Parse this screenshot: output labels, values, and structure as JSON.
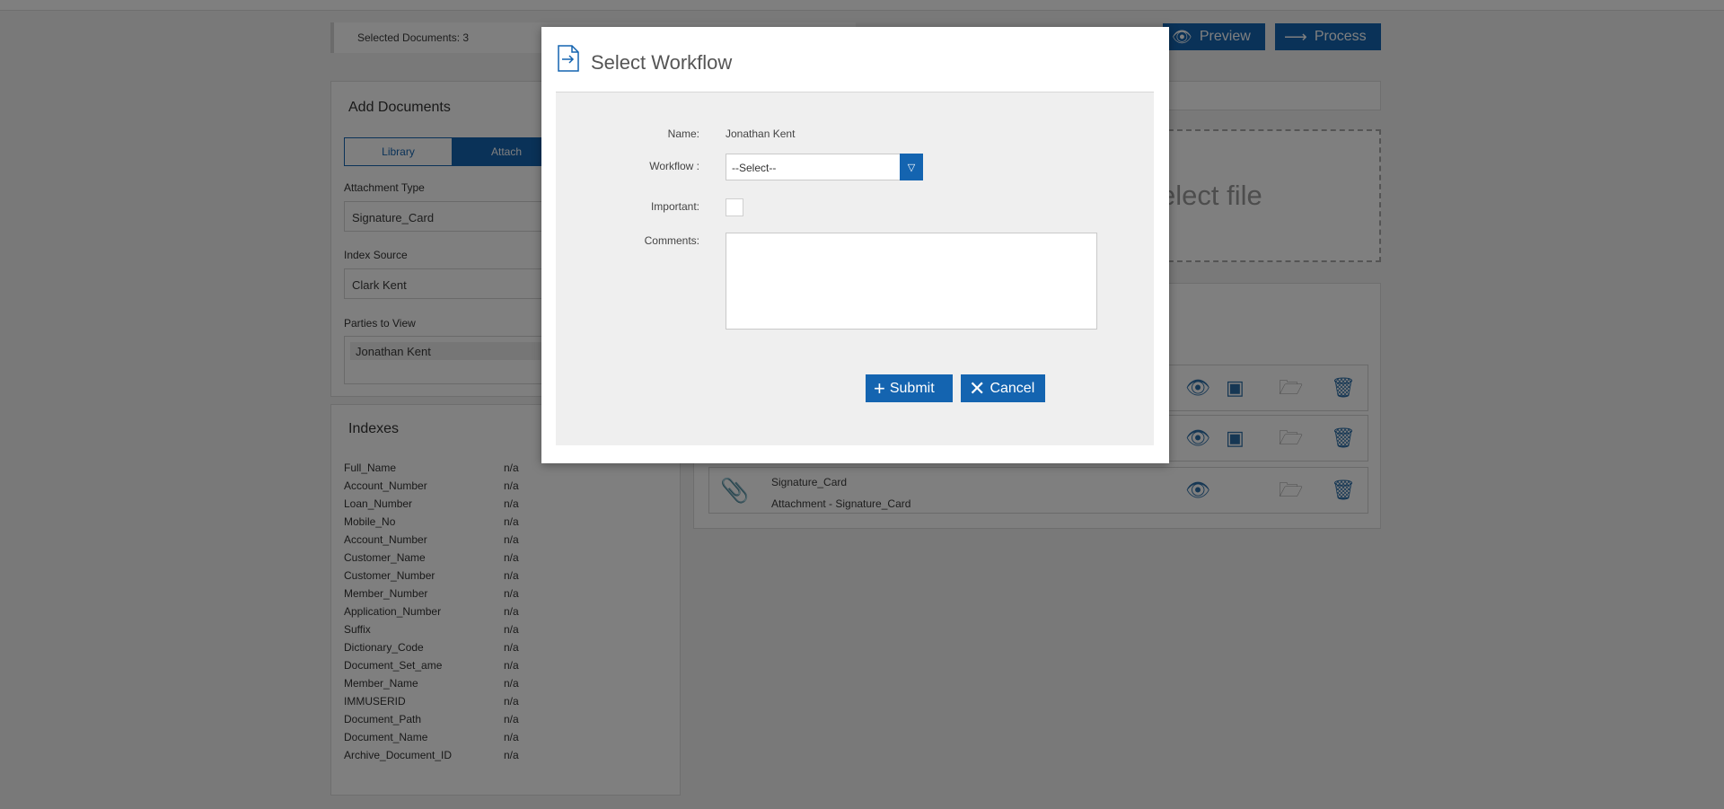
{
  "selected_docs": "Selected Documents: 3",
  "toolbar": {
    "preview_label": "Preview",
    "process_label": "Process"
  },
  "add_documents": {
    "title": "Add Documents",
    "tabs": [
      "Library",
      "Attach"
    ],
    "attachment_type_label": "Attachment Type",
    "attachment_type_value": "Signature_Card",
    "index_source_label": "Index Source",
    "index_source_value": "Clark Kent",
    "parties_label": "Parties to View",
    "parties": [
      "Jonathan Kent"
    ]
  },
  "indexes": {
    "title": "Indexes",
    "rows": [
      {
        "key": "Full_Name",
        "value": "n/a"
      },
      {
        "key": "Account_Number",
        "value": "n/a"
      },
      {
        "key": "Loan_Number",
        "value": "n/a"
      },
      {
        "key": "Mobile_No",
        "value": "n/a"
      },
      {
        "key": "Account_Number",
        "value": "n/a"
      },
      {
        "key": "Customer_Name",
        "value": "n/a"
      },
      {
        "key": "Customer_Number",
        "value": "n/a"
      },
      {
        "key": "Member_Number",
        "value": "n/a"
      },
      {
        "key": "Application_Number",
        "value": "n/a"
      },
      {
        "key": "Suffix",
        "value": "n/a"
      },
      {
        "key": "Dictionary_Code",
        "value": "n/a"
      },
      {
        "key": "Document_Set_ame",
        "value": "n/a"
      },
      {
        "key": "Member_Name",
        "value": "n/a"
      },
      {
        "key": "IMMUSERID",
        "value": "n/a"
      },
      {
        "key": "Document_Path",
        "value": "n/a"
      },
      {
        "key": "Document_Name",
        "value": "n/a"
      },
      {
        "key": "Archive_Document_ID",
        "value": "n/a"
      }
    ]
  },
  "dropzone_text": "elect file",
  "documents": [
    {
      "name": "Signature_Card",
      "subtitle": "Attachment - Signature_Card"
    }
  ],
  "modal": {
    "title": "Select Workflow",
    "name_label": "Name:",
    "name_value": "Jonathan Kent",
    "workflow_label": "Workflow :",
    "workflow_value": "--Select--",
    "important_label": "Important:",
    "comments_label": "Comments:",
    "comments_value": "",
    "submit_label": "Submit",
    "cancel_label": "Cancel"
  },
  "icons": {
    "preview": "eye-icon",
    "process": "arrow-right-icon",
    "submit": "plus-icon",
    "cancel": "close-icon",
    "modal_title": "document-arrow-icon",
    "dropdown": "chevron-down-icon"
  },
  "colors": {
    "accent": "#1464b0",
    "overlay": "rgba(0,0,0,0.5)"
  }
}
